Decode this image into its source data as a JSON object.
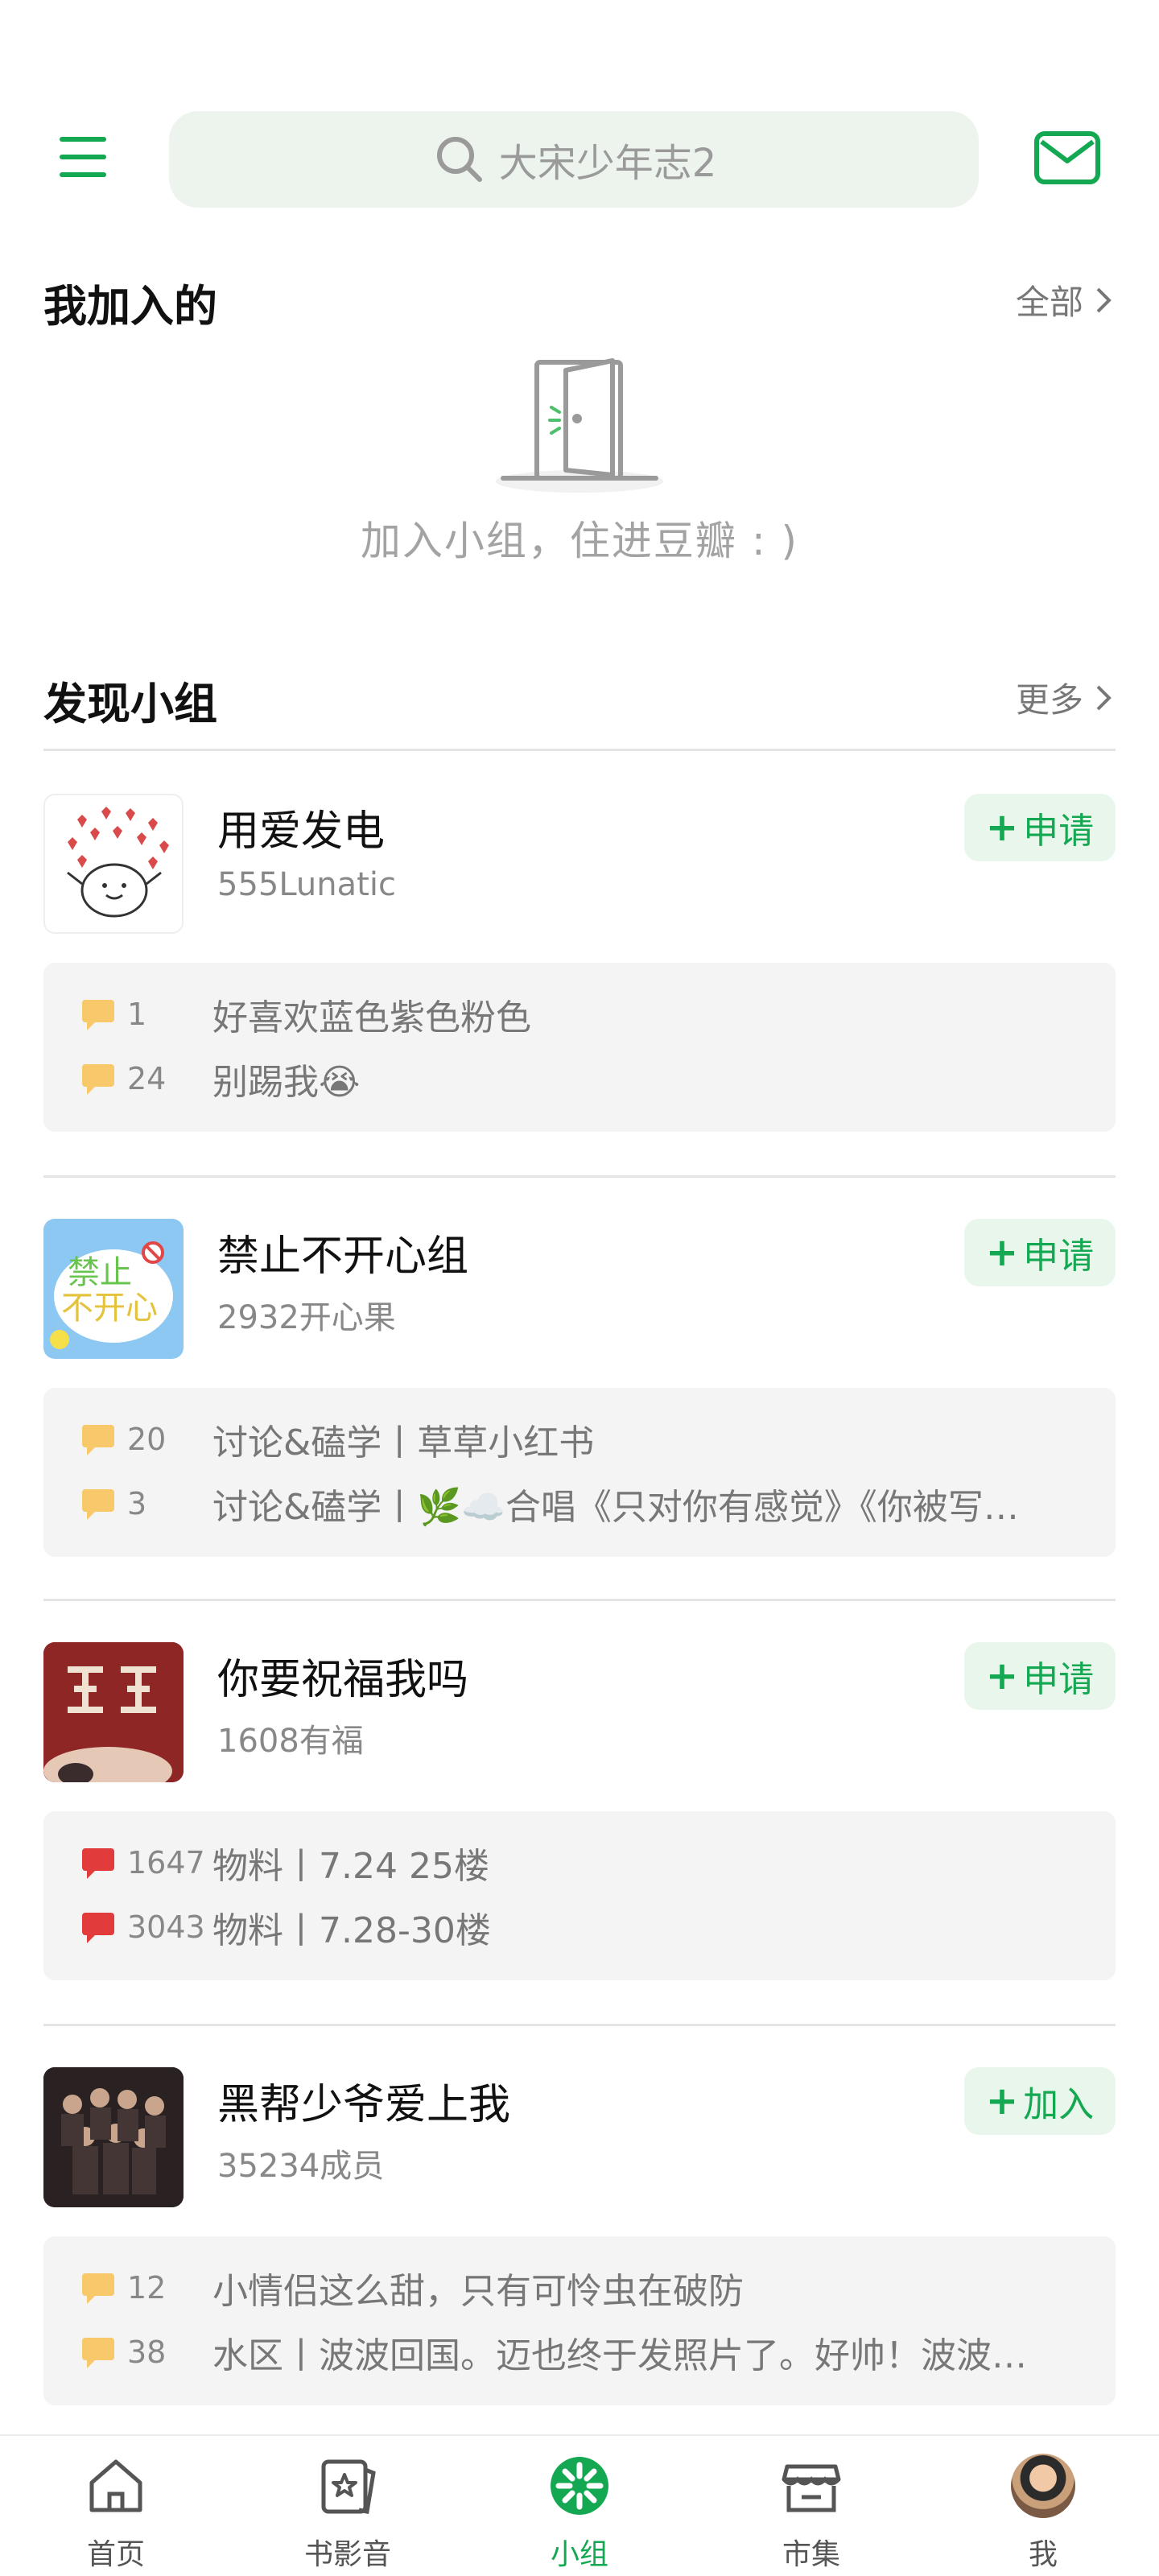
{
  "header": {
    "search_placeholder": "大宋少年志2"
  },
  "joined": {
    "title": "我加入的",
    "more": "全部",
    "empty_text": "加入小组，住进豆瓣 : )"
  },
  "discover": {
    "title": "发现小组",
    "more": "更多",
    "groups": [
      {
        "name": "用爱发电",
        "sub": "555Lunatic",
        "action": "申请",
        "posts": [
          {
            "count": "1",
            "title": "好喜欢蓝色紫色粉色"
          },
          {
            "count": "24",
            "title": "别踢我😭"
          }
        ]
      },
      {
        "name": "禁止不开心组",
        "sub": "2932开心果",
        "action": "申请",
        "posts": [
          {
            "count": "20",
            "title": "讨论&磕学丨草草小红书"
          },
          {
            "count": "3",
            "title": "讨论&磕学丨🌿☁️合唱《只对你有感觉》《你被写…"
          }
        ]
      },
      {
        "name": "你要祝福我吗",
        "sub": "1608有福",
        "action": "申请",
        "posts": [
          {
            "count": "1647",
            "title": "物料丨7.24 25楼"
          },
          {
            "count": "3043",
            "title": "物料丨7.28-30楼"
          }
        ]
      },
      {
        "name": "黑帮少爷爱上我",
        "sub": "35234成员",
        "action": "加入",
        "posts": [
          {
            "count": "12",
            "title": "小情侣这么甜，只有可怜虫在破防"
          },
          {
            "count": "38",
            "title": "水区丨波波回国。迈也终于发照片了。好帅！波波…"
          }
        ]
      }
    ]
  },
  "nav": {
    "items": [
      {
        "label": "首页",
        "icon": "home-icon"
      },
      {
        "label": "书影音",
        "icon": "media-icon"
      },
      {
        "label": "小组",
        "icon": "group-icon"
      },
      {
        "label": "市集",
        "icon": "market-icon"
      },
      {
        "label": "我",
        "icon": "avatar"
      }
    ]
  },
  "colors": {
    "accent": "#15a852",
    "hot_bubble": "#e23b3b",
    "normal_bubble": "#f7c96a"
  }
}
